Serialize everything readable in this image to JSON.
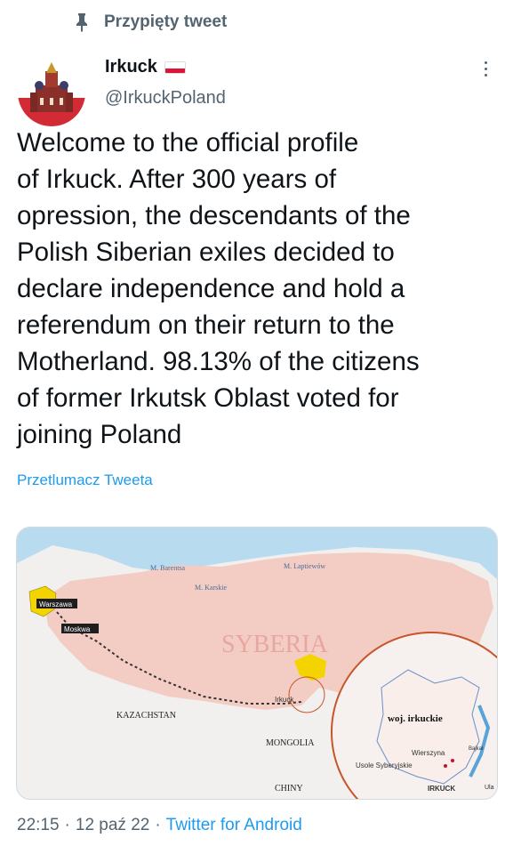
{
  "pinned": {
    "label": "Przypięty tweet"
  },
  "author": {
    "display_name": "Irkuck",
    "handle": "@IrkuckPoland"
  },
  "tweet": {
    "text": "Welcome to the official profile\nof Irkuck. After 300 years of\nopression, the descendants of the\nPolish Siberian exiles decided to\ndeclare independence and hold a\nreferendum on their return to the\nMotherland. 98.13% of the citizens\nof former Irkutsk Oblast voted for\njoining Poland",
    "translate_label": "Przetlumacz Tweeta"
  },
  "map": {
    "labels": {
      "barents": "M. Barentsa",
      "laptev": "M. Laptiewów",
      "kara": "M. Karskie",
      "warszawa": "Warszawa",
      "moskwa": "Moskwa",
      "syberia": "SYBERIA",
      "irkuck": "Irkuck",
      "kazachstan": "KAZACHSTAN",
      "mongolia": "MONGOLIA",
      "chiny": "CHINY",
      "woj": "woj. irkuckie",
      "wierszyna": "Wierszyna",
      "usole": "Usole Syberyjskie",
      "irkuck_caps": "IRKUCK",
      "ula": "Ula",
      "bajkal": "Bajkał"
    },
    "colors": {
      "sea": "#b9dbef",
      "land": "#f1f0ee",
      "russia": "#f3cdc4",
      "poland": "#f4d400",
      "circle": "#c8552a"
    }
  },
  "footer": {
    "time": "22:15",
    "date": "12 paź 22",
    "source": "Twitter for Android"
  },
  "icons": [
    "pin-icon",
    "more-icon",
    "flag-poland-icon"
  ]
}
